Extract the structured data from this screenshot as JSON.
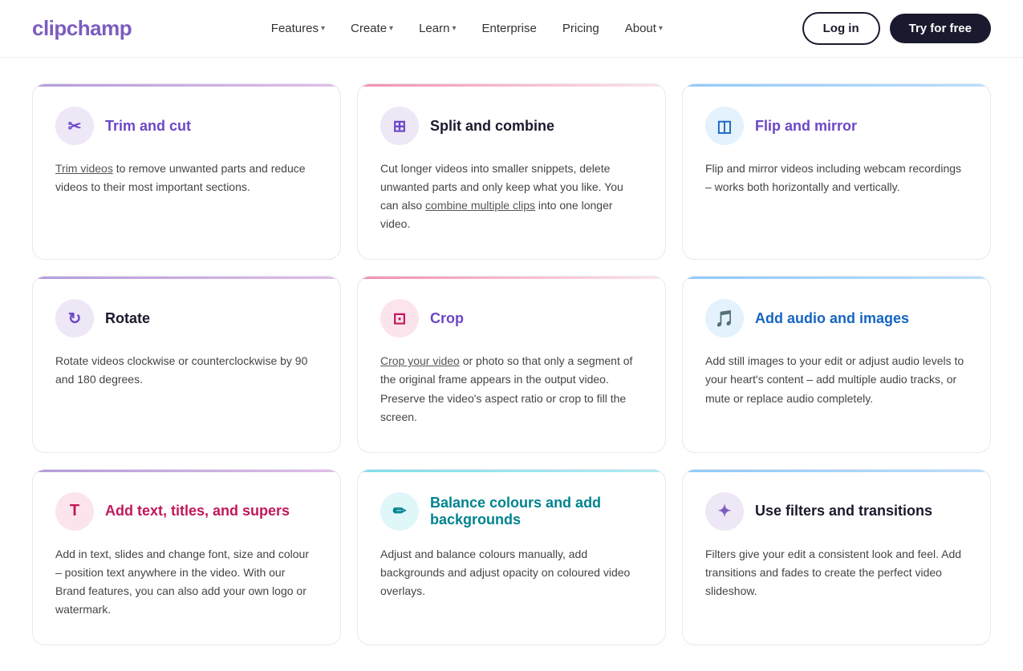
{
  "brand": {
    "logo_prefix": "clip",
    "logo_suffix": "champ"
  },
  "nav": {
    "links": [
      {
        "label": "Features",
        "has_dropdown": true
      },
      {
        "label": "Create",
        "has_dropdown": true
      },
      {
        "label": "Learn",
        "has_dropdown": true
      },
      {
        "label": "Enterprise",
        "has_dropdown": false
      },
      {
        "label": "Pricing",
        "has_dropdown": false
      },
      {
        "label": "About",
        "has_dropdown": true
      }
    ],
    "login_label": "Log in",
    "try_label": "Try for free"
  },
  "cards": [
    {
      "id": "trim-cut",
      "title": "Trim and cut",
      "title_style": "purple",
      "icon": "✂",
      "icon_style": "purple",
      "top_style": "purple-top",
      "body": "to remove unwanted parts and reduce videos to their most important sections.",
      "link_text": "Trim videos",
      "has_link": true
    },
    {
      "id": "split-combine",
      "title": "Split and combine",
      "title_style": "dark",
      "icon": "⊞",
      "icon_style": "purple",
      "top_style": "pink-top",
      "body": "Cut longer videos into smaller snippets, delete unwanted parts and only keep what you like. You can also combine multiple clips into one longer video.",
      "link_text": "combine multiple clips",
      "has_link": true
    },
    {
      "id": "flip-mirror",
      "title": "Flip and mirror",
      "title_style": "purple",
      "icon": "◫",
      "icon_style": "blue",
      "top_style": "blue-top",
      "body": "Flip and mirror videos including webcam recordings – works both horizontally and vertically.",
      "has_link": false
    },
    {
      "id": "rotate",
      "title": "Rotate",
      "title_style": "dark",
      "icon": "↻",
      "icon_style": "purple",
      "top_style": "purple-top",
      "body": "Rotate videos clockwise or counterclockwise by 90 and 180 degrees.",
      "has_link": false
    },
    {
      "id": "crop",
      "title": "Crop",
      "title_style": "purple",
      "icon": "⊡",
      "icon_style": "pink",
      "top_style": "pink-top",
      "body": "or photo so that only a segment of the original frame appears in the output video. Preserve the video's aspect ratio or crop to fill the screen.",
      "link_text": "Crop your video",
      "has_link": true
    },
    {
      "id": "add-audio-images",
      "title": "Add audio and images",
      "title_style": "blue",
      "icon": "🎵",
      "icon_style": "blue",
      "top_style": "blue-top",
      "body": "Add still images to your edit or adjust audio levels to your heart's content – add multiple audio tracks, or mute or replace audio completely.",
      "has_link": false
    },
    {
      "id": "add-text",
      "title": "Add text, titles, and supers",
      "title_style": "pink",
      "icon": "T",
      "icon_style": "pink",
      "top_style": "purple-top",
      "body": "Add in text, slides and change font, size and colour – position text anywhere in the video. With our Brand features, you can also add your own logo or watermark.",
      "has_link": false
    },
    {
      "id": "balance-colours",
      "title": "Balance colours and add backgrounds",
      "title_style": "teal",
      "icon": "✏",
      "icon_style": "teal",
      "top_style": "teal-top",
      "body": "Adjust and balance colours manually, add backgrounds and adjust opacity on coloured video overlays.",
      "has_link": false
    },
    {
      "id": "filters-transitions",
      "title": "Use filters and transitions",
      "title_style": "dark",
      "icon": "✦",
      "icon_style": "lavender",
      "top_style": "blue-top",
      "body": "Filters give your edit a consistent look and feel. Add transitions and fades to create the perfect video slideshow.",
      "has_link": false
    }
  ]
}
